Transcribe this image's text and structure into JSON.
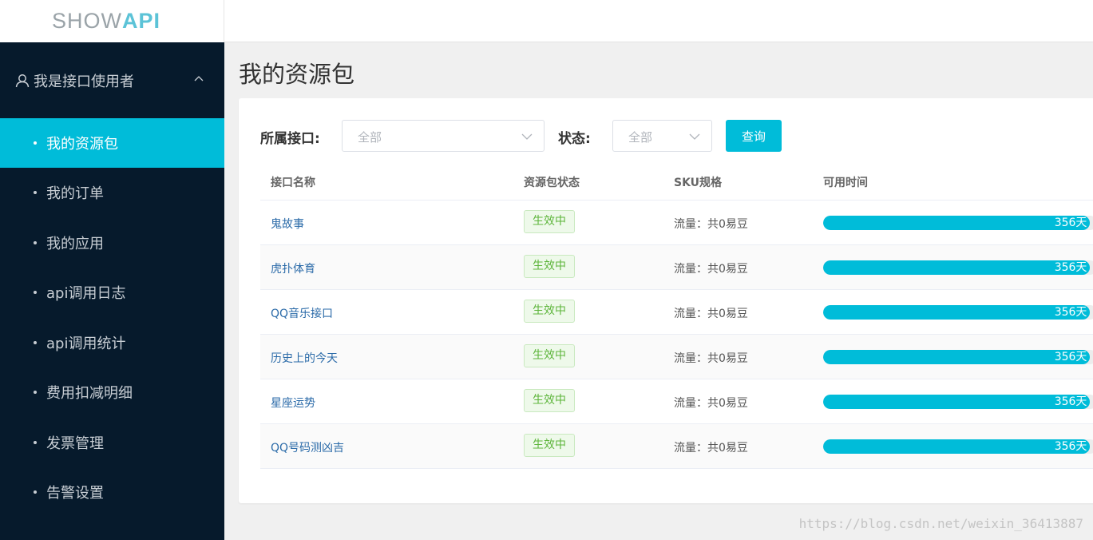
{
  "logo": {
    "part1": "SHOW",
    "part2": "API"
  },
  "sidebar": {
    "group_title": "我是接口使用者",
    "items": [
      {
        "label": "我的资源包",
        "active": true
      },
      {
        "label": "我的订单"
      },
      {
        "label": "我的应用"
      },
      {
        "label": "api调用日志"
      },
      {
        "label": "api调用统计"
      },
      {
        "label": "费用扣减明细"
      },
      {
        "label": "发票管理"
      },
      {
        "label": "告警设置"
      }
    ]
  },
  "page": {
    "title": "我的资源包"
  },
  "filters": {
    "api_label": "所属接口:",
    "api_placeholder": "全部",
    "status_label": "状态:",
    "status_placeholder": "全部",
    "query_label": "查询"
  },
  "table": {
    "headers": [
      "接口名称",
      "资源包状态",
      "SKU规格",
      "可用时间"
    ],
    "rows": [
      {
        "name": "鬼故事",
        "status": "生效中",
        "sku": "流量：共0易豆",
        "remaining": "356天",
        "remaining_pct": 97.5
      },
      {
        "name": "虎扑体育",
        "status": "生效中",
        "sku": "流量：共0易豆",
        "remaining": "356天",
        "remaining_pct": 97.5
      },
      {
        "name": "QQ音乐接口",
        "status": "生效中",
        "sku": "流量：共0易豆",
        "remaining": "356天",
        "remaining_pct": 97.5
      },
      {
        "name": "历史上的今天",
        "status": "生效中",
        "sku": "流量：共0易豆",
        "remaining": "356天",
        "remaining_pct": 97.5
      },
      {
        "name": "星座运势",
        "status": "生效中",
        "sku": "流量：共0易豆",
        "remaining": "356天",
        "remaining_pct": 97.5
      },
      {
        "name": "QQ号码测凶吉",
        "status": "生效中",
        "sku": "流量：共0易豆",
        "remaining": "356天",
        "remaining_pct": 97.5
      }
    ]
  },
  "watermark": "https://blog.csdn.net/weixin_36413887",
  "colors": {
    "accent": "#00bcd9",
    "sidebar_bg": "#061a2c",
    "status_green": "#5db53b",
    "link": "#2a6aa8"
  }
}
